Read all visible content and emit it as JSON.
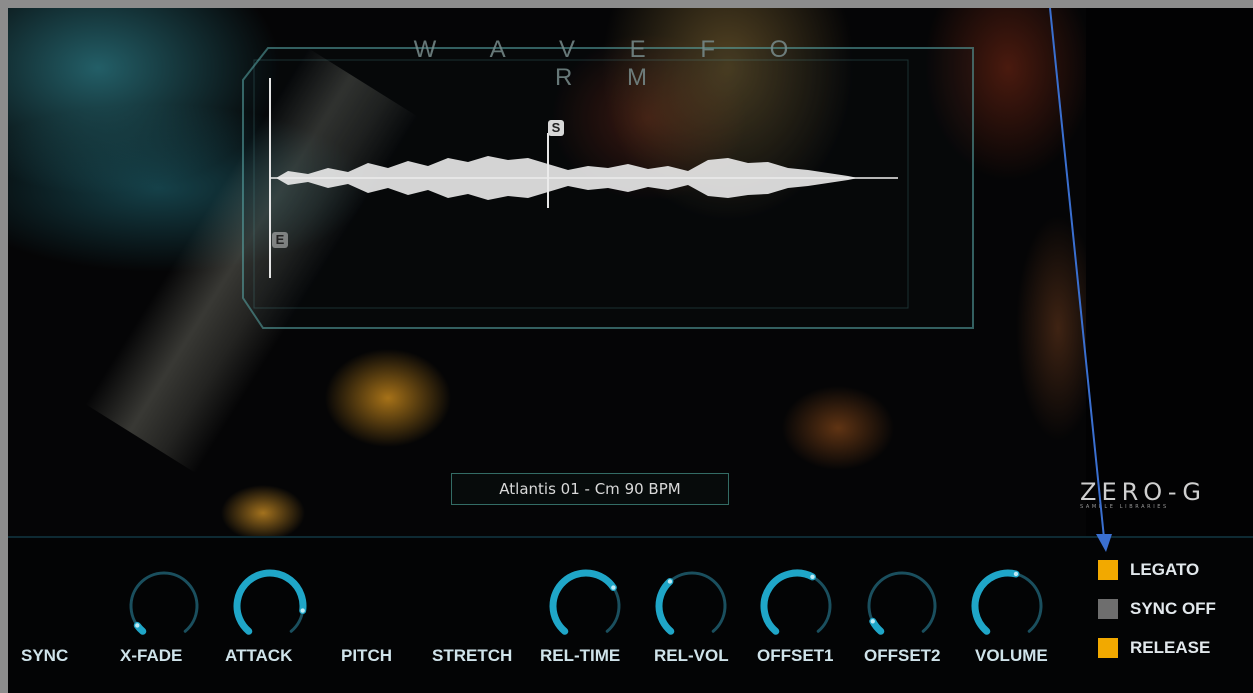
{
  "waveform": {
    "title": "W A V E F O R M",
    "start_marker": "S",
    "end_marker": "E"
  },
  "sample_name": "Atlantis 01 - Cm 90 BPM",
  "logo": {
    "main": "ZERO-G",
    "sub": "SAMPLE LIBRARIES"
  },
  "knobs": [
    {
      "key": "sync",
      "label": "SYNC",
      "shown": false,
      "value": 0
    },
    {
      "key": "xfade",
      "label": "X-FADE",
      "shown": true,
      "value": 0.05
    },
    {
      "key": "attack",
      "label": "ATTACK",
      "shown": true,
      "value": 0.85
    },
    {
      "key": "pitch",
      "label": "PITCH",
      "shown": false,
      "value": 0
    },
    {
      "key": "stretch",
      "label": "STRETCH",
      "shown": false,
      "value": 0
    },
    {
      "key": "reltime",
      "label": "REL-TIME",
      "shown": true,
      "value": 0.7
    },
    {
      "key": "relvol",
      "label": "REL-VOL",
      "shown": true,
      "value": 0.35
    },
    {
      "key": "offset1",
      "label": "OFFSET1",
      "shown": true,
      "value": 0.6
    },
    {
      "key": "offset2",
      "label": "OFFSET2",
      "shown": true,
      "value": 0.08
    },
    {
      "key": "volume",
      "label": "VOLUME",
      "shown": true,
      "value": 0.55
    }
  ],
  "toggles": [
    {
      "label": "LEGATO",
      "on": true
    },
    {
      "label": "SYNC OFF",
      "on": false
    },
    {
      "label": "RELEASE",
      "on": true
    }
  ],
  "colors": {
    "knob_track": "#1a4f5e",
    "knob_active": "#1fa6c8",
    "toggle_on": "#f2a900",
    "toggle_off": "#6e6e6e",
    "annotation_arrow": "#3a6fd0"
  }
}
